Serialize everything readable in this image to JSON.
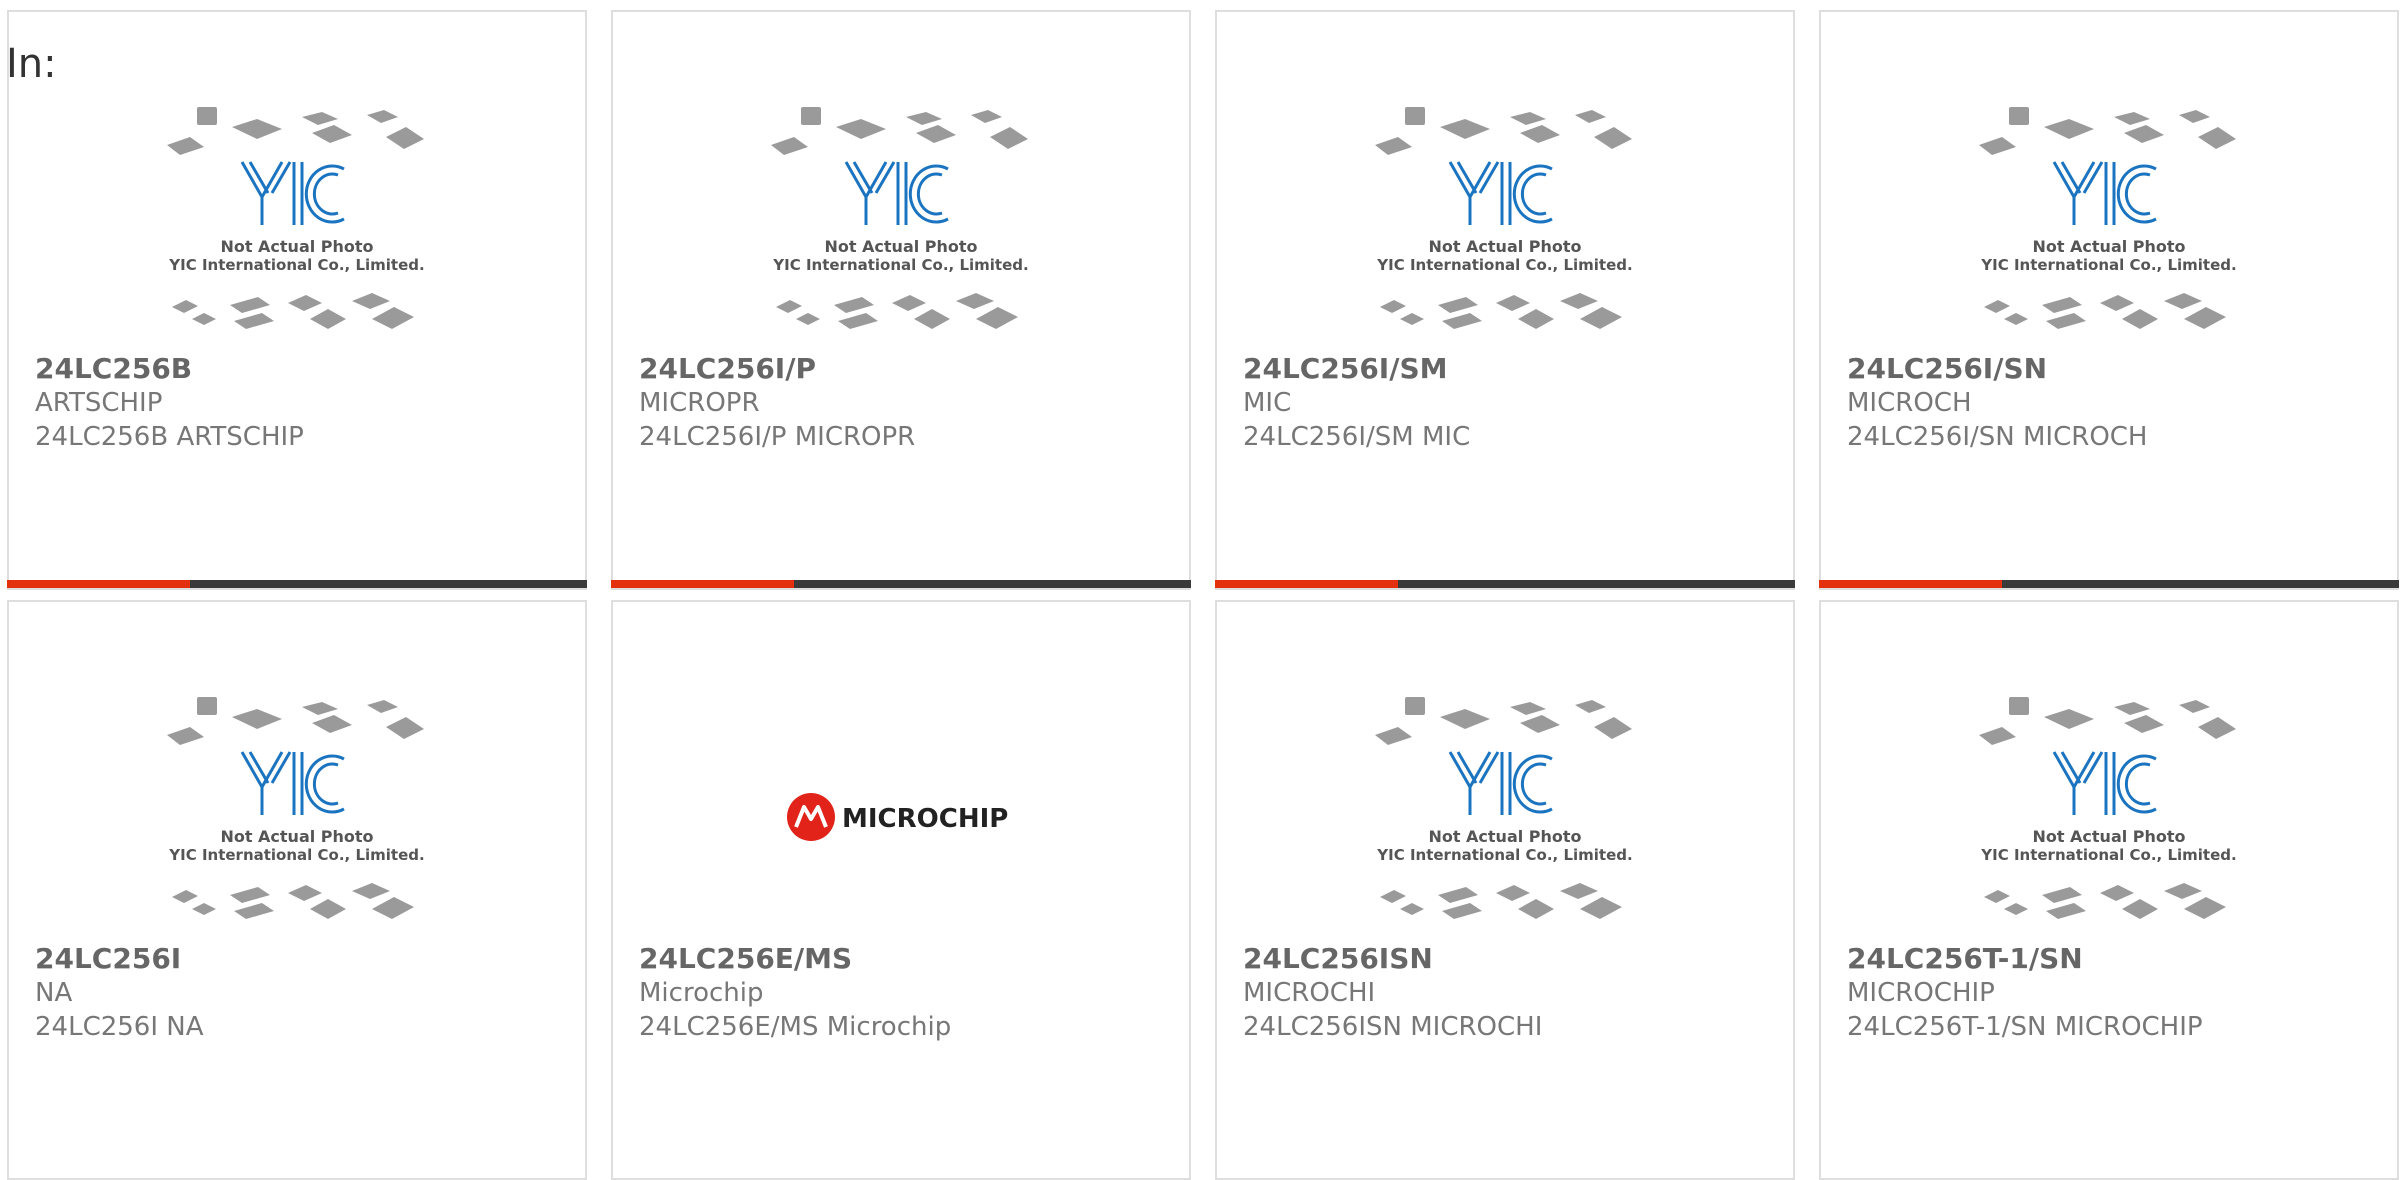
{
  "header": {
    "label": "In:"
  },
  "placeholder": {
    "logo_text": "YIC",
    "line1": "Not Actual Photo",
    "line2": "YIC International Co., Limited."
  },
  "brand_logo": {
    "text": "MICROCHIP"
  },
  "colors": {
    "accent": "#e2310c",
    "bar": "#3a3a3a",
    "logo_blue": "#1b74c0"
  },
  "products": [
    {
      "part": "24LC256B",
      "mfr": "ARTSCHIP",
      "desc": "24LC256B ARTSCHIP",
      "image": "yic-placeholder"
    },
    {
      "part": "24LC256I/P",
      "mfr": "MICROPR",
      "desc": "24LC256I/P MICROPR",
      "image": "yic-placeholder"
    },
    {
      "part": "24LC256I/SM",
      "mfr": "MIC",
      "desc": "24LC256I/SM MIC",
      "image": "yic-placeholder"
    },
    {
      "part": "24LC256I/SN",
      "mfr": "MICROCH",
      "desc": "24LC256I/SN MICROCH",
      "image": "yic-placeholder"
    },
    {
      "part": "24LC256I",
      "mfr": "NA",
      "desc": "24LC256I NA",
      "image": "yic-placeholder"
    },
    {
      "part": "24LC256E/MS",
      "mfr": "Microchip",
      "desc": "24LC256E/MS Microchip",
      "image": "microchip-logo"
    },
    {
      "part": "24LC256ISN",
      "mfr": "MICROCHI",
      "desc": "24LC256ISN MICROCHI",
      "image": "yic-placeholder"
    },
    {
      "part": "24LC256T-1/SN",
      "mfr": "MICROCHIP",
      "desc": "24LC256T-1/SN MICROCHIP",
      "image": "yic-placeholder"
    }
  ]
}
